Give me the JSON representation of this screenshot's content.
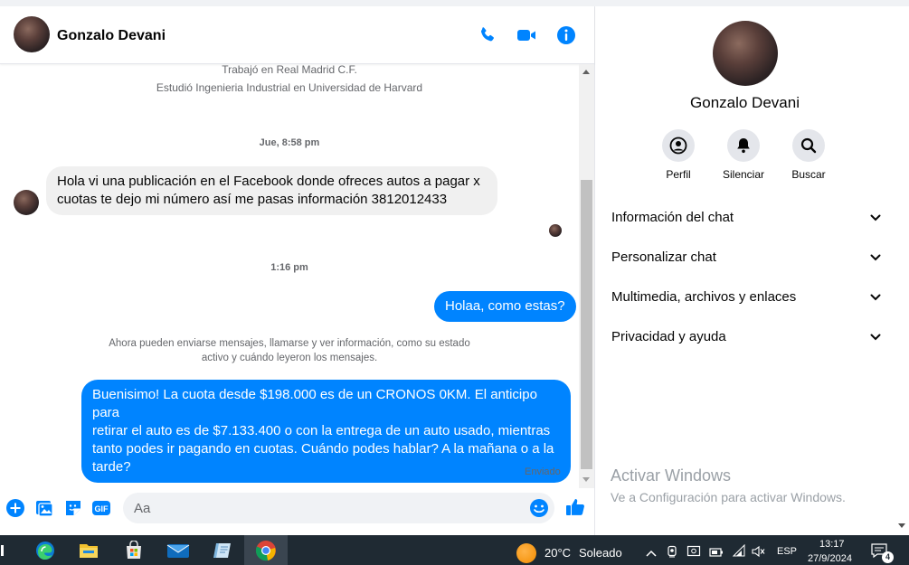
{
  "header": {
    "contact_name": "Gonzalo Devani",
    "icons": [
      "phone-icon",
      "video-icon",
      "info-icon"
    ]
  },
  "colors": {
    "messenger_blue": "#0084ff",
    "incoming_bubble": "#f0f0f0",
    "secondary_text": "#65676b"
  },
  "conversation": {
    "profile_line1": "Trabajó en Real Madrid C.F.",
    "profile_line2": "Estudió Ingenieria Industrial en Universidad de Harvard",
    "timestamp1": "Jue, 8:58 pm",
    "incoming_message_line1": "Hola vi una publicación en el Facebook donde ofreces autos a pagar x",
    "incoming_message_line2": "cuotas te dejo mi número así me pasas información 3812012433",
    "timestamp2": "1:16 pm",
    "outgoing_message1": "Holaa, como estas?",
    "notice_line1": "Ahora pueden enviarse mensajes, llamarse y ver información, como su estado",
    "notice_line2": "activo y cuándo leyeron los mensajes.",
    "outgoing_message2_line1": "Buenisimo! La cuota desde $198.000 es de un CRONOS 0KM. El anticipo para",
    "outgoing_message2_line2": "retirar el auto es de $7.133.400 o con la entrega de un auto usado, mientras",
    "outgoing_message2_line3": "tanto podes ir pagando en cuotas. Cuándo podes hablar? A la mañana o a la",
    "outgoing_message2_line4": "tarde?",
    "status": "Enviado"
  },
  "composer": {
    "placeholder": "Aa",
    "icons": [
      "plus-icon",
      "image-icon",
      "sticker-icon",
      "gif-icon",
      "emoji-icon",
      "thumbs-up-icon"
    ],
    "gif_label": "GIF"
  },
  "info_panel": {
    "name": "Gonzalo Devani",
    "actions": [
      {
        "label": "Perfil",
        "icon": "profile-icon"
      },
      {
        "label": "Silenciar",
        "icon": "bell-icon"
      },
      {
        "label": "Buscar",
        "icon": "search-icon"
      }
    ],
    "sections": [
      {
        "label": "Información del chat"
      },
      {
        "label": "Personalizar chat"
      },
      {
        "label": "Multimedia, archivos y enlaces"
      },
      {
        "label": "Privacidad y ayuda"
      }
    ],
    "watermark_title": "Activar Windows",
    "watermark_subtitle": "Ve a Configuración para activar Windows."
  },
  "taskbar": {
    "weather_temp": "20°C",
    "weather_desc": "Soleado",
    "language": "ESP",
    "time": "13:17",
    "date": "27/9/2024",
    "notification_count": "4"
  }
}
